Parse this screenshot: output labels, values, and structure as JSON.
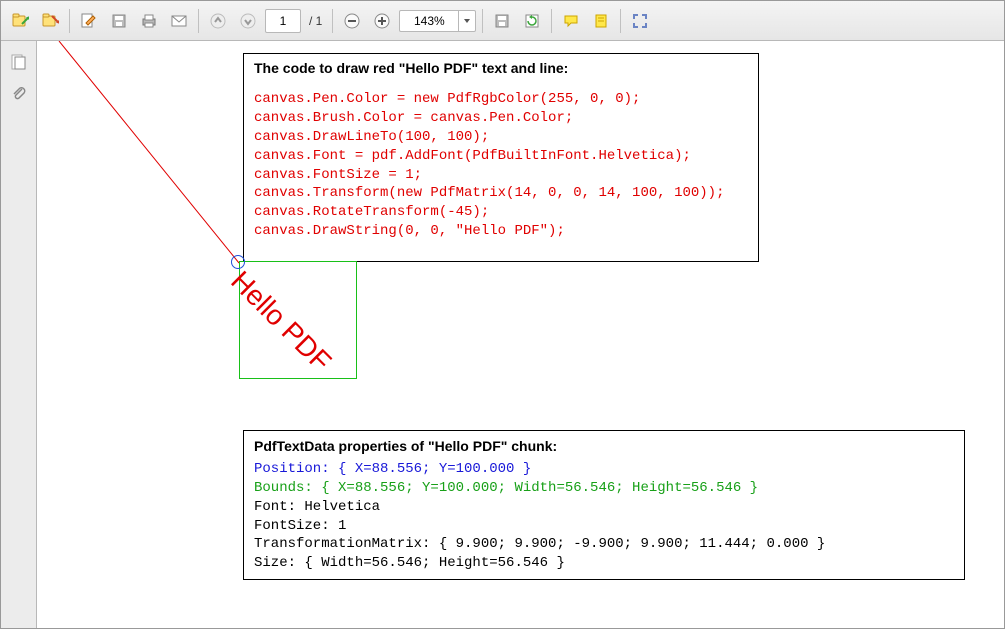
{
  "toolbar": {
    "page_current": "1",
    "page_total": "/ 1",
    "zoom_value": "143%"
  },
  "box1": {
    "title": "The code to draw red \"Hello PDF\" text and line:",
    "code": "canvas.Pen.Color = new PdfRgbColor(255, 0, 0);\ncanvas.Brush.Color = canvas.Pen.Color;\ncanvas.DrawLineTo(100, 100);\ncanvas.Font = pdf.AddFont(PdfBuiltInFont.Helvetica);\ncanvas.FontSize = 1;\ncanvas.Transform(new PdfMatrix(14, 0, 0, 14, 100, 100));\ncanvas.RotateTransform(-45);\ncanvas.DrawString(0, 0, \"Hello PDF\");"
  },
  "hello_pdf_text": "Hello PDF",
  "box2": {
    "title": "PdfTextData properties of \"Hello PDF\" chunk:",
    "position": "Position: { X=88.556; Y=100.000 }",
    "bounds": "Bounds: { X=88.556; Y=100.000; Width=56.546; Height=56.546 }",
    "font": "Font: Helvetica",
    "fontsize": "FontSize: 1",
    "matrix": "TransformationMatrix: { 9.900; 9.900; -9.900; 9.900; 11.444; 0.000 }",
    "size": "Size: { Width=56.546; Height=56.546 }"
  }
}
